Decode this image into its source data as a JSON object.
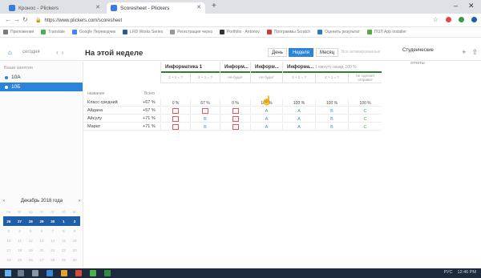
{
  "browser": {
    "tabs": [
      {
        "label": "Кронос - Plickers",
        "active": false
      },
      {
        "label": "Scoresheet - Plickers",
        "active": true
      }
    ],
    "address": "https://www.plickers.com/scoresheet",
    "bookmarks": [
      "Приложения",
      "Translate",
      "Google Переводчик",
      "LRD Works Series",
      "Регистрация через",
      "Portfolio · Antonov",
      "Программы Scratch",
      "Оценить результат",
      "ПОЛ App Installer"
    ]
  },
  "header": {
    "home_icon": "home-icon",
    "today_label": "сегодня",
    "prev": "‹",
    "next": "›",
    "week_title": "На этой неделе",
    "view_modes": [
      "День",
      "Неделя",
      "Месяц"
    ],
    "active_view": "Неделя",
    "ghost_text": "Все активированные",
    "students_btn": "Студенческие",
    "reports_label": "отчеты"
  },
  "sidebar": {
    "groups_header": "Ваши занятия",
    "groups": [
      {
        "label": "10А",
        "active": false
      },
      {
        "label": "10Б",
        "active": true
      }
    ],
    "calendar": {
      "month_label": "Декабрь 2018 года",
      "prev": "‹",
      "next": "›",
      "weekdays": [
        "пн",
        "вт",
        "ср",
        "чт",
        "пт",
        "сб",
        "вс"
      ],
      "weeks": [
        [
          "26",
          "27",
          "28",
          "29",
          "30",
          "1",
          "2"
        ],
        [
          "3",
          "4",
          "5",
          "6",
          "7",
          "8",
          "9"
        ],
        [
          "10",
          "11",
          "12",
          "13",
          "14",
          "15",
          "16"
        ],
        [
          "17",
          "18",
          "19",
          "20",
          "21",
          "22",
          "23"
        ],
        [
          "24",
          "25",
          "26",
          "27",
          "28",
          "29",
          "30"
        ],
        [
          "31",
          "1",
          "2",
          "3",
          "4",
          "5",
          "6"
        ]
      ],
      "selected_week_index": 0
    }
  },
  "table": {
    "col_name": "название",
    "col_total": "Всего",
    "activities": [
      {
        "title": "Информатика 1",
        "sub": "",
        "q": [
          "2 + 1 = ?",
          "2 + 1 = ?"
        ]
      },
      {
        "title": "Информ...",
        "sub": "",
        "q": [
          "Не будет"
        ]
      },
      {
        "title": "Информ...",
        "sub": "",
        "q": [
          "Не будет"
        ]
      },
      {
        "title": "Информа...",
        "sub": "1 минуту назад",
        "q": [
          "2 + 1 = ?",
          "2 + 1 = ?",
          "Не сделает отправит"
        ]
      }
    ],
    "percent_100": "100 %",
    "class_avg": {
      "name": "Класс средний",
      "total": "+67 %",
      "cells": [
        "0 %",
        "67 %",
        "0 %",
        "100 %",
        "100 %",
        "100 %",
        "100 %"
      ]
    },
    "students": [
      {
        "name": "Айдана",
        "total": "+57 %",
        "cells": [
          "red",
          "red",
          "red",
          "A",
          "A",
          "B",
          "C"
        ]
      },
      {
        "name": "Айсулу",
        "total": "+71 %",
        "cells": [
          "red",
          "B",
          "red",
          "A",
          "A",
          "B",
          "C"
        ]
      },
      {
        "name": "Марат",
        "total": "+71 %",
        "cells": [
          "red",
          "B",
          "red",
          "A",
          "A",
          "B",
          "C"
        ]
      }
    ]
  },
  "taskbar": {
    "lang": "РУС",
    "time": "12:46 PM"
  }
}
